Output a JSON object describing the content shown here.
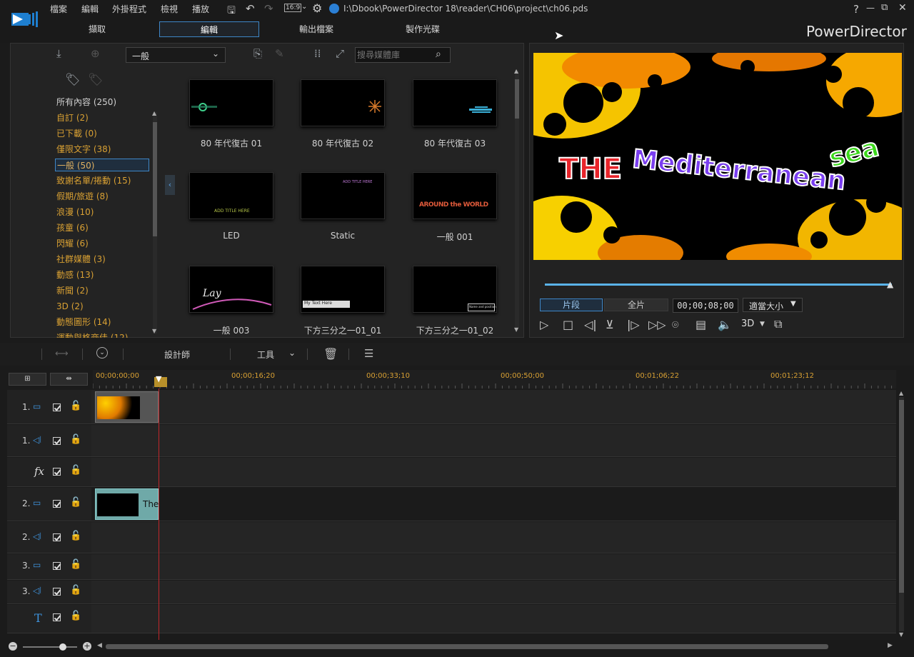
{
  "menu": [
    "檔案",
    "編輯",
    "外掛程式",
    "檢視",
    "播放"
  ],
  "aspect": "16:9",
  "project_path": "I:\\Dbook\\PowerDirector 18\\reader\\CH06\\project\\ch06.pds",
  "window_controls": [
    "?",
    "—",
    "⧉",
    "✕"
  ],
  "mode_tabs": [
    "擷取",
    "編輯",
    "輸出檔案",
    "製作光碟"
  ],
  "brand": "PowerDirector",
  "library": {
    "dropdown_value": "一般",
    "search_placeholder": "搜尋媒體庫",
    "categories": [
      "所有內容 (250)",
      "自訂  (2)",
      "已下載  (0)",
      "僅限文字  (38)",
      "一般  (50)",
      "致謝名單/捲動  (15)",
      "假期/旅遊  (8)",
      "浪漫  (10)",
      "孩童  (6)",
      "閃耀  (6)",
      "社群媒體  (3)",
      "動感  (13)",
      "新聞  (2)",
      "3D  (2)",
      "動態圖形  (14)",
      "運動與格商佳  (12)"
    ],
    "active_category_index": 4,
    "items": [
      {
        "label": "80 年代復古 01",
        "thumb_text": ""
      },
      {
        "label": "80 年代復古 02",
        "thumb_text": ""
      },
      {
        "label": "80 年代復古 03",
        "thumb_text": ""
      },
      {
        "label": "LED",
        "thumb_text": "ADD TITLE HERE"
      },
      {
        "label": "Static",
        "thumb_text": "ADD TITLE HERE"
      },
      {
        "label": "一般 001",
        "thumb_text": "AROUND the WORLD"
      },
      {
        "label": "一般 003",
        "thumb_text": "Lay"
      },
      {
        "label": "下方三分之一01_01",
        "thumb_text": "My Text Here"
      },
      {
        "label": "下方三分之一01_02",
        "thumb_text": "Name and position"
      }
    ]
  },
  "preview": {
    "title_words": [
      "THE",
      "Mediterranean",
      "sea"
    ],
    "mode_buttons": [
      "片段",
      "全片"
    ],
    "timecode": "00;00;08;00",
    "fit_option": "適當大小",
    "three_d_label": "3D",
    "progress": 1.0
  },
  "timeline": {
    "toolbar": {
      "designer": "設計師",
      "tools": "工具"
    },
    "ruler_marks": [
      "00;00;00;00",
      "00;00;16;20",
      "00;00;33;10",
      "00;00;50;00",
      "00;01;06;22",
      "00;01;23;12"
    ],
    "tracks": [
      {
        "num": "1.",
        "kind": "video"
      },
      {
        "num": "1.",
        "kind": "audio"
      },
      {
        "num": "",
        "kind": "fx"
      },
      {
        "num": "2.",
        "kind": "video"
      },
      {
        "num": "2.",
        "kind": "audio"
      },
      {
        "num": "3.",
        "kind": "video"
      },
      {
        "num": "3.",
        "kind": "audio"
      },
      {
        "num": "",
        "kind": "title"
      }
    ],
    "title_clip_text": "The"
  },
  "colors": {
    "accent": "#3e86c7",
    "category": "#d8a033",
    "playhead": "#c0262a",
    "clip_title": "#6fa9a8"
  }
}
